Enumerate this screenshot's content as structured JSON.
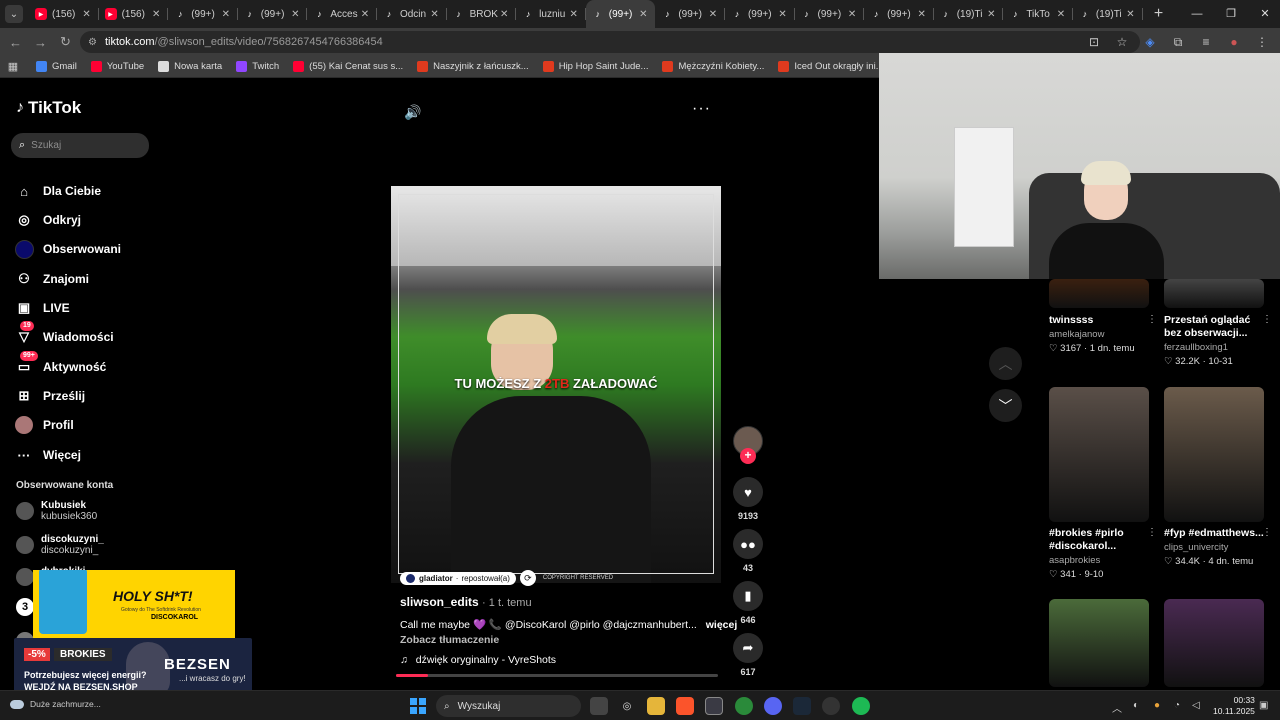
{
  "browser": {
    "tabs": [
      {
        "title": "(156)",
        "favicon": "youtube-icon",
        "active": false
      },
      {
        "title": "(156)",
        "favicon": "youtube-icon",
        "active": false
      },
      {
        "title": "(99+)",
        "favicon": "tiktok-icon",
        "active": false
      },
      {
        "title": "(99+)",
        "favicon": "tiktok-icon",
        "active": false
      },
      {
        "title": "Acces",
        "favicon": "tiktok-icon",
        "active": false
      },
      {
        "title": "Odcin",
        "favicon": "tiktok-icon",
        "active": false
      },
      {
        "title": "BROK",
        "favicon": "tiktok-icon",
        "active": false
      },
      {
        "title": "luzniu",
        "favicon": "tiktok-icon",
        "active": false
      },
      {
        "title": "(99+)",
        "favicon": "tiktok-icon",
        "active": true
      },
      {
        "title": "(99+)",
        "favicon": "tiktok-icon",
        "active": false
      },
      {
        "title": "(99+)",
        "favicon": "tiktok-icon",
        "active": false
      },
      {
        "title": "(99+)",
        "favicon": "tiktok-icon",
        "active": false
      },
      {
        "title": "(99+)",
        "favicon": "tiktok-icon",
        "active": false
      },
      {
        "title": "(19)Ti",
        "favicon": "tiktok-icon",
        "active": false
      },
      {
        "title": "TikTo",
        "favicon": "tiktok-icon",
        "active": false
      },
      {
        "title": "(19)Ti",
        "favicon": "tiktok-icon",
        "active": false
      }
    ],
    "url_host": "tiktok.com",
    "url_path": "/@sliwson_edits/video/7568267454766386454",
    "bookmarks": [
      {
        "label": "Gmail",
        "icon": "gmail-icon",
        "color": "#4285f4"
      },
      {
        "label": "YouTube",
        "icon": "youtube-icon",
        "color": "#ff0033"
      },
      {
        "label": "Nowa karta",
        "icon": "globe-icon",
        "color": "#dddddd"
      },
      {
        "label": "Twitch",
        "icon": "twitch-icon",
        "color": "#9146ff"
      },
      {
        "label": "(55) Kai Cenat sus s...",
        "icon": "youtube-icon",
        "color": "#ff0033"
      },
      {
        "label": "Naszyjnik z łańcuszk...",
        "icon": "shop-icon",
        "color": "#e03a1e"
      },
      {
        "label": "Hip Hop Saint Jude...",
        "icon": "shop-icon",
        "color": "#e03a1e"
      },
      {
        "label": "Mężczyźni Kobiety...",
        "icon": "shop-icon",
        "color": "#e03a1e"
      },
      {
        "label": "Iced Out okrągły ini...",
        "icon": "shop-icon",
        "color": "#e03a1e"
      }
    ]
  },
  "sidebar": {
    "brand": "TikTok",
    "search_placeholder": "Szukaj",
    "nav": [
      {
        "label": "Dla Ciebie",
        "icon": "home-icon"
      },
      {
        "label": "Odkryj",
        "icon": "compass-icon"
      },
      {
        "label": "Obserwowani",
        "icon": "following-avatar-icon"
      },
      {
        "label": "Znajomi",
        "icon": "friends-icon"
      },
      {
        "label": "LIVE",
        "icon": "live-icon"
      },
      {
        "label": "Wiadomości",
        "icon": "messages-icon",
        "badge": "19"
      },
      {
        "label": "Aktywność",
        "icon": "activity-icon",
        "badge": "99+"
      },
      {
        "label": "Prześlij",
        "icon": "upload-icon"
      },
      {
        "label": "Profil",
        "icon": "profile-avatar-icon"
      },
      {
        "label": "Więcej",
        "icon": "more-icon"
      }
    ],
    "following_title": "Obserwowane konta",
    "following": [
      {
        "name": "Kubusiek",
        "handle": "kubusiek360"
      },
      {
        "name": "discokuzyni_",
        "handle": "discokuzyni_"
      },
      {
        "name": "dvbrokiki",
        "handle": "dvbrokiki"
      }
    ]
  },
  "ads": {
    "ad1_title": "HOLY SH*T!",
    "ad1_sub": "Gotowy do The Softdrink Revolution",
    "ad1_brand": "DISCOKAROL",
    "ad2_discount": "-5%",
    "ad2_brand": "BROKIES",
    "ad2_line1": "Potrzebujesz więcej energii?",
    "ad2_line2": "WEJDŹ NA BEZSEN.SHOP",
    "ad2_big": "BEZSEN",
    "ad2_small": "...i wracasz do gry!"
  },
  "video": {
    "caption_before": "TU MOŻESZ Z",
    "caption_red": "2TB",
    "caption_after": "ZAŁADOWAĆ",
    "repost_user": "gladiator",
    "repost_text": "repostował(a)",
    "copyright": "COPYRIGHT RESERVED",
    "author": "sliwson_edits",
    "ago": "· 1 t. temu",
    "description": "Call me maybe 💜 📞 @DiscoKarol @pirlo @dajczmanhubert...",
    "more": "więcej",
    "translate": "Zobacz tłumaczenie",
    "sound": "dźwięk oryginalny - VyreShots",
    "progress": 0.1,
    "likes": "9193",
    "comments": "43",
    "saves": "646",
    "shares": "617"
  },
  "grid": [
    {
      "title": "twinssss",
      "user": "amelkajanow",
      "stats": "3167 · 1 dn. temu",
      "col": 0,
      "row": 0,
      "color": "#3a2010"
    },
    {
      "title": "Przestań oglądać bez obserwacji...",
      "user": "ferzaullboxing1",
      "stats": "32.2K · 10-31",
      "col": 1,
      "row": 0,
      "color": "#444444"
    },
    {
      "title": "#brokies #pirlo #discokarol...",
      "user": "asapbrokies",
      "stats": "341 · 9-10",
      "col": 0,
      "row": 1,
      "color": "#5a4f48"
    },
    {
      "title": "#fyp #edmatthews...",
      "user": "clips_univercity",
      "stats": "34.4K · 4 dn. temu",
      "col": 1,
      "row": 1,
      "color": "#6b5b4b"
    },
    {
      "title": "",
      "user": "",
      "stats": "",
      "col": 0,
      "row": 2,
      "color": "#4b6b3a"
    },
    {
      "title": "",
      "user": "",
      "stats": "",
      "col": 1,
      "row": 2,
      "color": "#4a2a52"
    }
  ],
  "taskbar": {
    "weather": "Duże zachmurze...",
    "search": "Wyszukaj",
    "time": "00:33",
    "date": "10.11.2025"
  }
}
